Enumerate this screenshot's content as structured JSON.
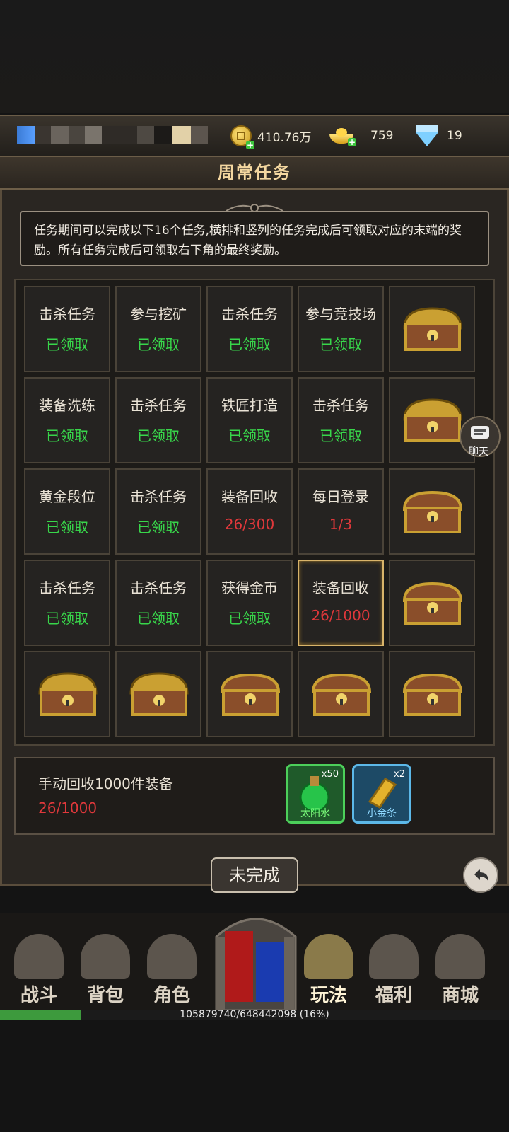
{
  "header": {
    "title": "周常任务",
    "resources": {
      "gold": "410.76万",
      "ingot": "759",
      "diamond": "19"
    }
  },
  "description": "任务期间可以完成以下16个任务,横排和竖列的任务完成后可领取对应的末端的奖励。所有任务完成后可领取右下角的最终奖励。",
  "grid": {
    "rows": [
      [
        {
          "name": "击杀任务",
          "status": "已领取",
          "state": "done"
        },
        {
          "name": "参与挖矿",
          "status": "已领取",
          "state": "done"
        },
        {
          "name": "击杀任务",
          "status": "已领取",
          "state": "done"
        },
        {
          "name": "参与竞技场",
          "status": "已领取",
          "state": "done"
        },
        {
          "chest": "open"
        }
      ],
      [
        {
          "name": "装备洗练",
          "status": "已领取",
          "state": "done"
        },
        {
          "name": "击杀任务",
          "status": "已领取",
          "state": "done"
        },
        {
          "name": "铁匠打造",
          "status": "已领取",
          "state": "done"
        },
        {
          "name": "击杀任务",
          "status": "已领取",
          "state": "done"
        },
        {
          "chest": "open"
        }
      ],
      [
        {
          "name": "黄金段位",
          "status": "已领取",
          "state": "done"
        },
        {
          "name": "击杀任务",
          "status": "已领取",
          "state": "done"
        },
        {
          "name": "装备回收",
          "status": "26/300",
          "state": "progress"
        },
        {
          "name": "每日登录",
          "status": "1/3",
          "state": "progress"
        },
        {
          "chest": "closed"
        }
      ],
      [
        {
          "name": "击杀任务",
          "status": "已领取",
          "state": "done"
        },
        {
          "name": "击杀任务",
          "status": "已领取",
          "state": "done"
        },
        {
          "name": "获得金币",
          "status": "已领取",
          "state": "done"
        },
        {
          "name": "装备回收",
          "status": "26/1000",
          "state": "progress",
          "selected": true
        },
        {
          "chest": "closed"
        }
      ],
      [
        {
          "chest": "open"
        },
        {
          "chest": "open"
        },
        {
          "chest": "closed"
        },
        {
          "chest": "closed"
        },
        {
          "chest": "closed"
        }
      ]
    ]
  },
  "chat_label": "聊天",
  "selected_task": {
    "name": "手动回收1000件装备",
    "progress": "26/1000",
    "rewards": [
      {
        "name": "太阳水",
        "qty": "x50",
        "color": "green"
      },
      {
        "name": "小金条",
        "qty": "x2",
        "color": "blue"
      }
    ],
    "button": "未完成"
  },
  "nav": {
    "items": [
      {
        "label": "战斗",
        "icon": "swords-icon"
      },
      {
        "label": "背包",
        "icon": "backpack-icon"
      },
      {
        "label": "角色",
        "icon": "character-icon"
      },
      {
        "label": "玩法",
        "icon": "gameplay-icon",
        "active": true
      },
      {
        "label": "福利",
        "icon": "chest-icon"
      },
      {
        "label": "商城",
        "icon": "shop-icon"
      }
    ]
  },
  "exp": {
    "text": "105879740/648442098 (16%)",
    "fraction": 0.16
  },
  "colors": {
    "done": "#38d64a",
    "progress": "#e0383b",
    "accent": "#f4d7a0"
  }
}
